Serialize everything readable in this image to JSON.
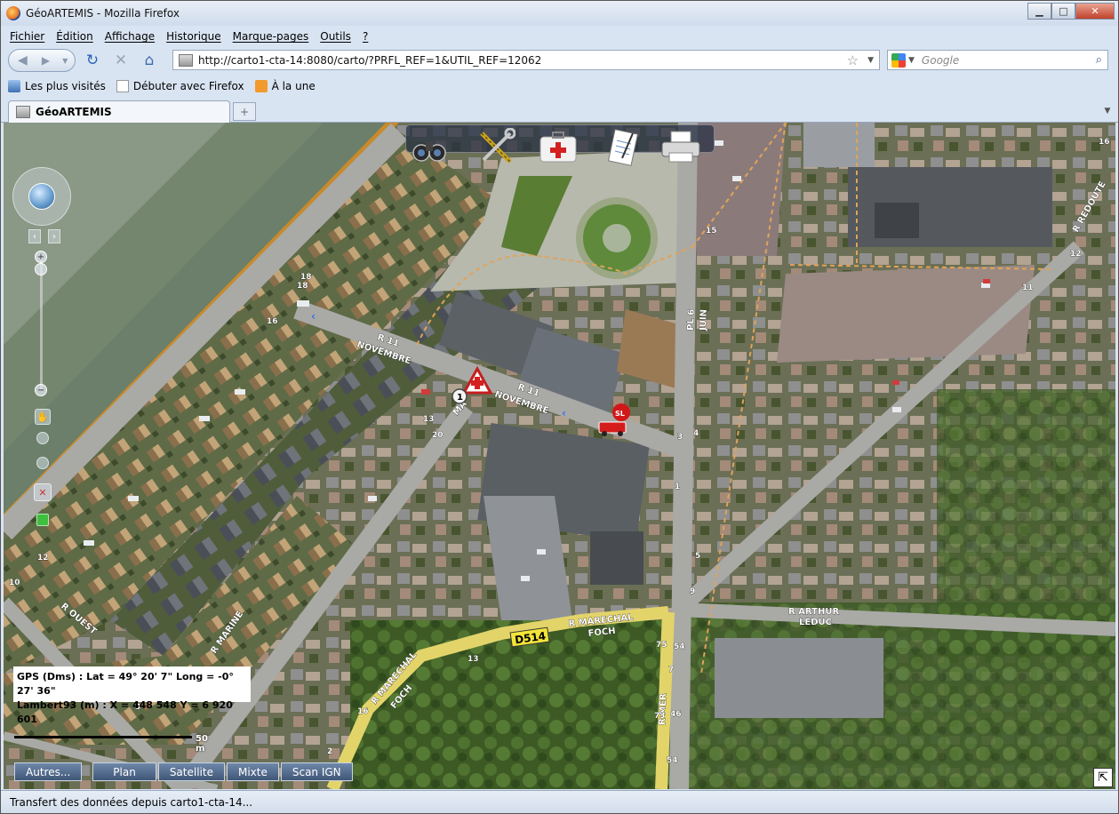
{
  "window": {
    "title": "GéoARTEMIS - Mozilla Firefox",
    "minimize": "▁",
    "maximize": "□",
    "close": "✕"
  },
  "menu": [
    "Fichier",
    "Édition",
    "Affichage",
    "Historique",
    "Marque-pages",
    "Outils",
    "?"
  ],
  "nav": {
    "url": "http://carto1-cta-14:8080/carto/?PRFL_REF=1&UTIL_REF=12062",
    "search_placeholder": "Google"
  },
  "bookmarks": [
    "Les plus visités",
    "Débuter avec Firefox",
    "À la une"
  ],
  "tab": {
    "title": "GéoARTEMIS",
    "new_tab": "+"
  },
  "map": {
    "tools": [
      "binoculars-icon",
      "tools-icon",
      "first-aid-kit-icon",
      "notepad-icon",
      "printer-icon"
    ],
    "gps_line1": "GPS (Dms) : Lat = 49° 20' 7\"  Long = -0° 27' 36\"",
    "gps_line2": "Lambert93 (m) : X = 448 548   Y = 6 920 601",
    "scale_label": "50 m",
    "buttons": {
      "autres": "Autres...",
      "plan": "Plan",
      "satellite": "Satellite",
      "mixte": "Mixte",
      "scan_ign": "Scan IGN"
    },
    "road_labels": {
      "r11_nov_1a": "R 11",
      "r11_nov_1b": "NOVEMBRE",
      "r11_nov_2a": "R 11",
      "r11_nov_2b": "NOVEMBRE",
      "pl6juin_a": "PL 6",
      "pl6juin_b": "JUIN",
      "redoute": "R REDOUTE",
      "marechal_foch_a": "R MARECHAL",
      "marechal_foch_b": "FOCH",
      "marechal_foch2_a": "R MARECHAL",
      "marechal_foch2_b": "FOCH",
      "arthur_leduc_a": "R ARTHUR",
      "arthur_leduc_b": "LEDUC",
      "r_ouest": "R OUEST",
      "r_marine": "R MARINE",
      "r_mer": "R MER",
      "d514": "D514",
      "ma": "MA"
    },
    "markers": {
      "sl": "SL",
      "circle_num": "1"
    },
    "house_numbers": [
      "16",
      "18",
      "13",
      "20",
      "15",
      "3",
      "4",
      "1",
      "5",
      "9",
      "75",
      "54",
      "73",
      "46",
      "54",
      "13",
      "12",
      "10",
      "16",
      "11",
      "12",
      "2",
      "3",
      "7",
      "16",
      "18"
    ]
  },
  "status": "Transfert des données depuis carto1-cta-14..."
}
